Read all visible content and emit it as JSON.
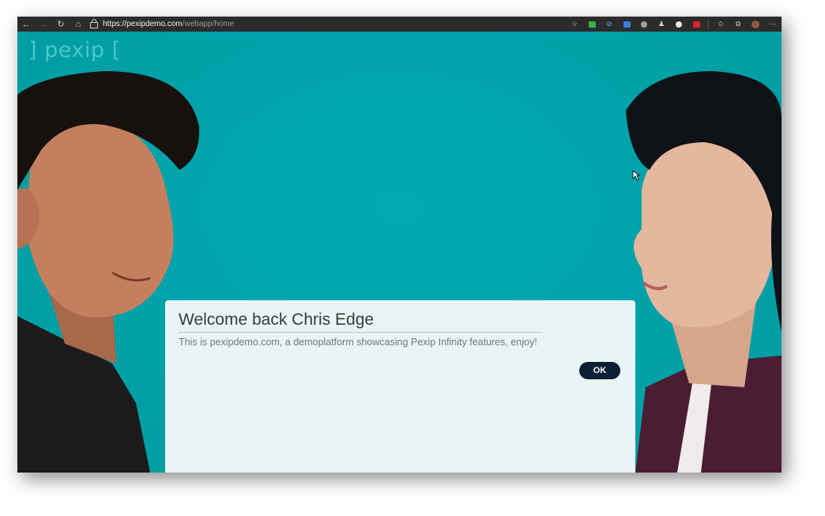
{
  "browser": {
    "url_host": "https://pexipdemo.com",
    "url_path": "/webapp/home",
    "nav": {
      "back": "←",
      "forward": "→",
      "reload": "↻",
      "home": "⌂"
    },
    "extensions": [
      "star-add-icon",
      "green-extension-icon",
      "link-extension-icon",
      "grid-extension-icon",
      "color-extension-icon",
      "person-extension-icon",
      "circle-extension-icon",
      "red-extension-icon",
      "favorites-icon",
      "collections-icon",
      "profile-avatar",
      "more-icon"
    ]
  },
  "page": {
    "logo": "] pexip [",
    "dialog": {
      "title": "Welcome back Chris Edge",
      "message": "This is pexipdemo.com, a demoplatform showcasing Pexip Infinity features, enjoy!",
      "ok_label": "OK"
    }
  },
  "colors": {
    "background": "#00a0a6",
    "dialog": "#e8f5f4",
    "button": "#0b2133"
  }
}
